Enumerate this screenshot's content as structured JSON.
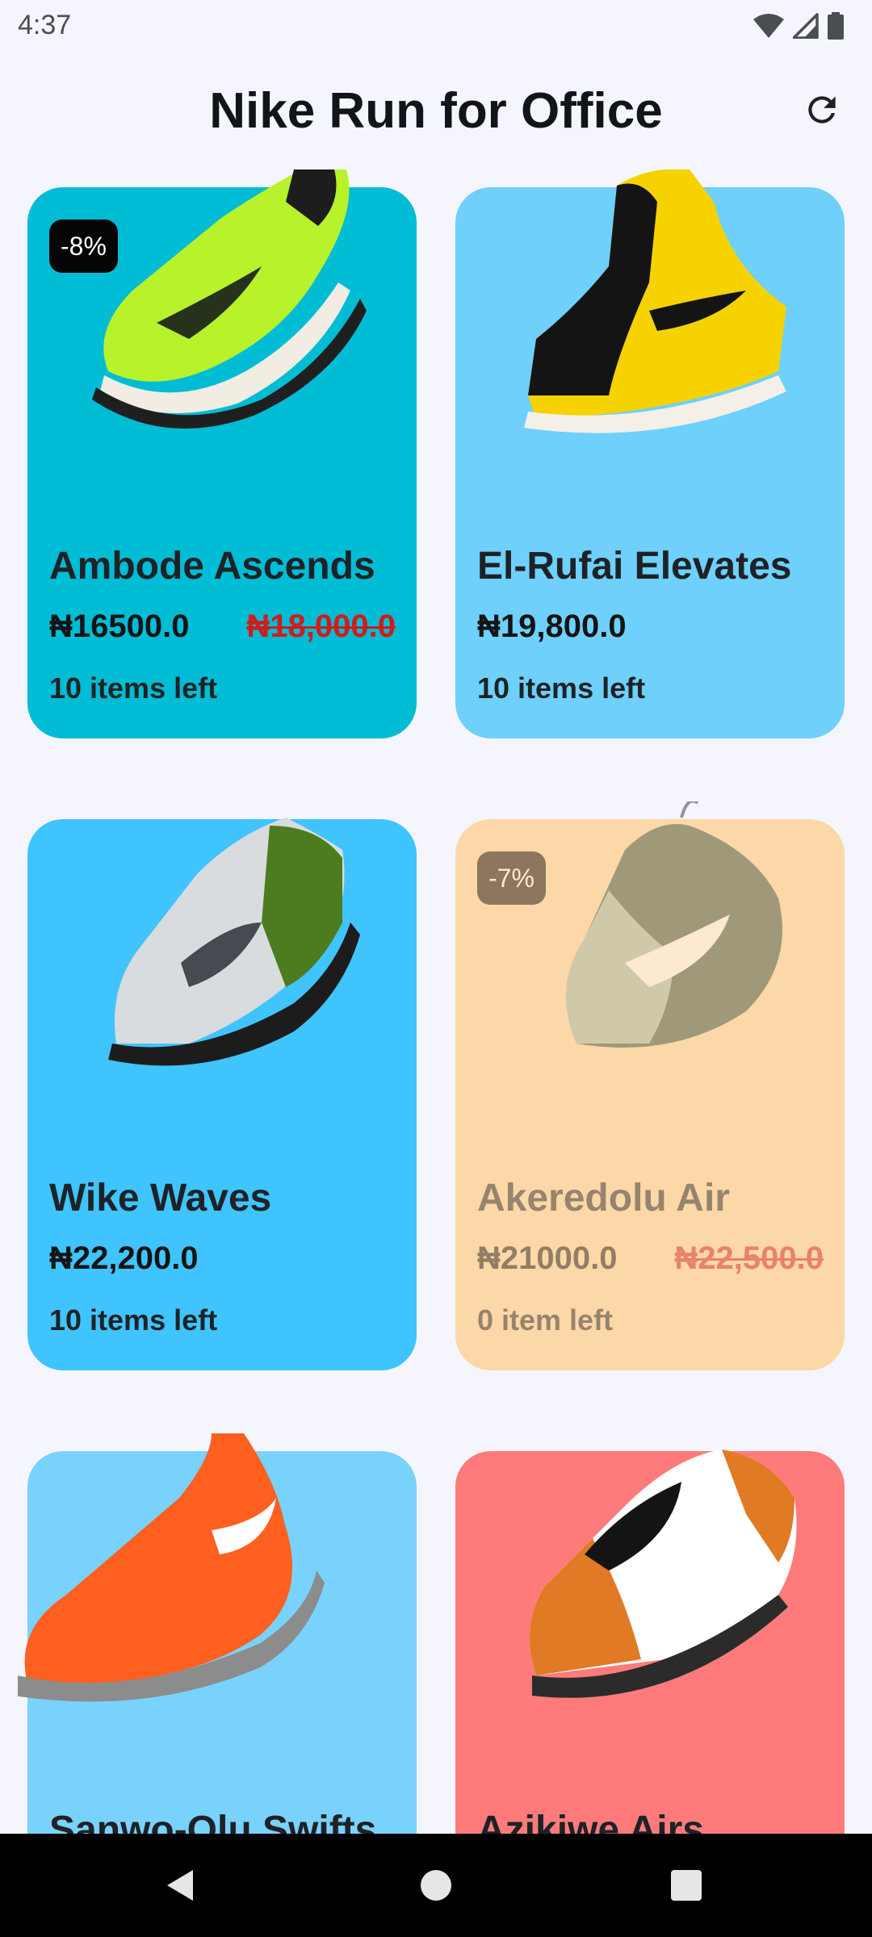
{
  "status_bar": {
    "time": "4:37",
    "icons": [
      "wifi-icon",
      "signal-icon",
      "battery-icon"
    ]
  },
  "header": {
    "title": "Nike Run for Office",
    "refresh_icon": "refresh-icon"
  },
  "colors": {
    "background": "#f5f6fd",
    "card_teal": "#00bcd4",
    "card_light_blue": "#6fd0fc",
    "card_sky": "#40c4fe",
    "card_peach": "#fcd7a8",
    "card_sky_light": "#79d2fc",
    "card_salmon": "#ff7b7b",
    "discount_red": "#d01c1c"
  },
  "products": [
    {
      "name": "Ambode Ascends",
      "price": "₦16500.0",
      "old_price": "₦18,000.0",
      "stock": "10 items left",
      "discount": "-8%",
      "shoe": "green-running-shoe"
    },
    {
      "name": "El-Rufai Elevates",
      "price": "₦19,800.0",
      "stock": "10 items left",
      "shoe": "yellow-black-high-top"
    },
    {
      "name": "Wike Waves",
      "price": "₦22,200.0",
      "stock": "10 items left",
      "shoe": "grey-green-air-max"
    },
    {
      "name": "Akeredolu Air",
      "price": "₦21000.0",
      "old_price": "₦22,500.0",
      "stock": "0 item left",
      "discount": "-7%",
      "shoe": "mint-basketball-shoe"
    },
    {
      "name": "Sanwo-Olu Swifts",
      "shoe": "orange-high-top"
    },
    {
      "name": "Azikiwe Airs",
      "shoe": "orange-black-white-low"
    }
  ],
  "nav_bar": {
    "icons": [
      "back-icon",
      "home-icon",
      "recents-icon"
    ]
  }
}
